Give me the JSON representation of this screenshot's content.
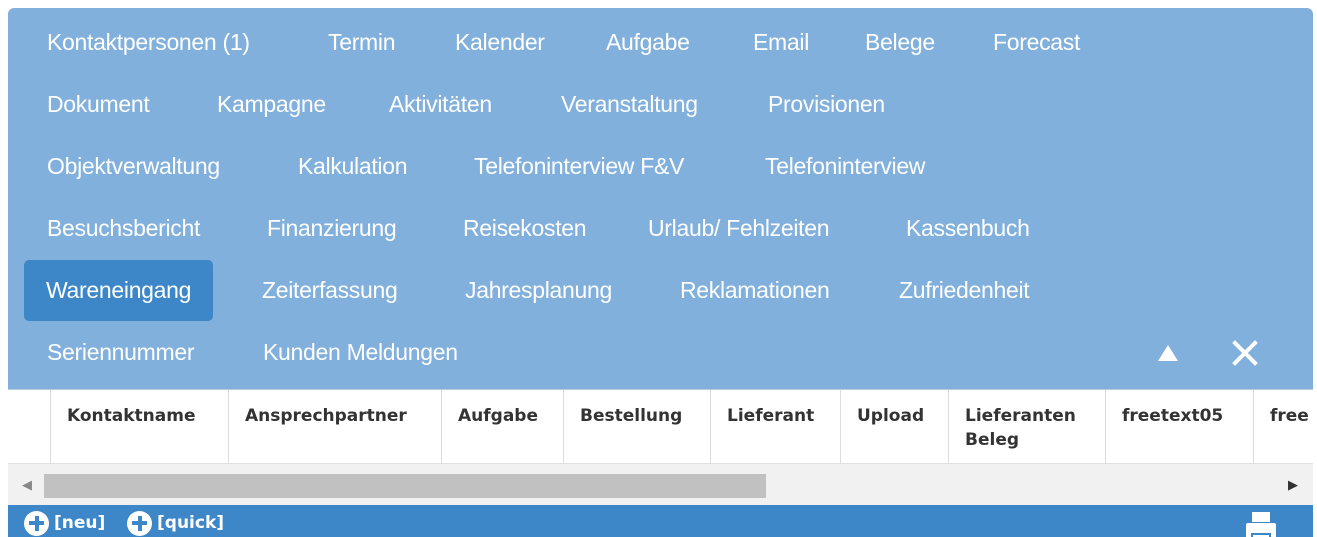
{
  "tabs": {
    "row1": [
      "Kontaktpersonen (1)",
      "Termin",
      "Kalender",
      "Aufgabe",
      "Email",
      "Belege",
      "Forecast"
    ],
    "row2": [
      "Dokument",
      "Kampagne",
      "Aktivitäten",
      "Veranstaltung",
      "Provisionen"
    ],
    "row3": [
      "Objektverwaltung",
      "Kalkulation",
      "Telefoninterview F&V",
      "Telefoninterview"
    ],
    "row4": [
      "Besuchsbericht",
      "Finanzierung",
      "Reisekosten",
      "Urlaub/ Fehlzeiten",
      "Kassenbuch"
    ],
    "row5": [
      "Wareneingang",
      "Zeiterfassung",
      "Jahresplanung",
      "Reklamationen",
      "Zufriedenheit"
    ],
    "row6": [
      "Seriennummer",
      "Kunden Meldungen"
    ],
    "active": "Wareneingang"
  },
  "controls": {
    "collapse_icon": "triangle-up-icon",
    "close_icon": "close-icon"
  },
  "table": {
    "columns": [
      "Kontaktname",
      "Ansprechpartner",
      "Aufgabe",
      "Bestellung",
      "Lieferant",
      "Upload",
      "Lieferanten Beleg",
      "freetext05",
      "free"
    ]
  },
  "footer": {
    "new_label": "[neu]",
    "quick_label": "[quick]",
    "print_icon": "printer-icon"
  },
  "colors": {
    "panel": "#82b0dd",
    "active_tab": "#3d87c9",
    "footer": "#3d87c9"
  }
}
